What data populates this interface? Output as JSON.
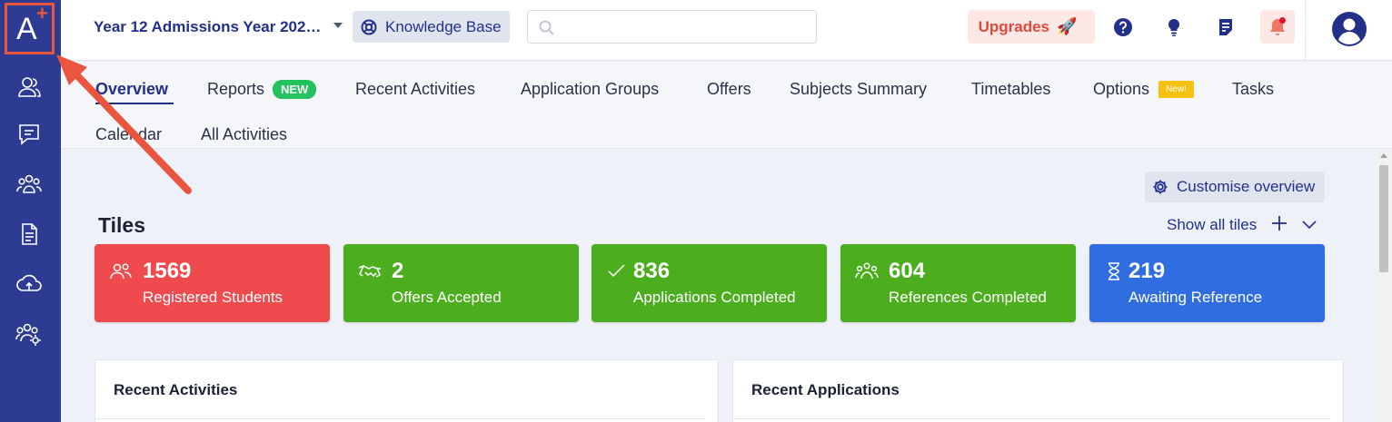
{
  "sidebar": {
    "logo_letter": "A",
    "logo_plus": "+",
    "icons": [
      "users-icon",
      "chat-icon",
      "group-icon",
      "document-icon",
      "cloud-upload-icon",
      "group-settings-icon"
    ]
  },
  "header": {
    "year_label": "Year 12 Admissions Year 202…",
    "knowledge_base_label": "Knowledge Base",
    "search_placeholder": "",
    "upgrades_label": "Upgrades",
    "upgrades_icon": "🚀"
  },
  "tabs": {
    "items": [
      {
        "label": "Overview"
      },
      {
        "label": "Reports"
      },
      {
        "label": "Recent Activities"
      },
      {
        "label": "Application Groups"
      },
      {
        "label": "Offers"
      },
      {
        "label": "Subjects Summary"
      },
      {
        "label": "Timetables"
      },
      {
        "label": "Options"
      },
      {
        "label": "Tasks"
      },
      {
        "label": "Calendar"
      },
      {
        "label": "All Activities"
      }
    ],
    "reports_badge": "NEW",
    "options_badge": "New!"
  },
  "overview": {
    "customise_label": "Customise overview",
    "tiles_title": "Tiles",
    "show_all_label": "Show all tiles",
    "tiles": [
      {
        "value": "1569",
        "label": "Registered Students",
        "color": "#ef4b4f",
        "icon": "users-icon"
      },
      {
        "value": "2",
        "label": "Offers Accepted",
        "color": "#4cae1f",
        "icon": "handshake-icon"
      },
      {
        "value": "836",
        "label": "Applications Completed",
        "color": "#4cae1f",
        "icon": "check-icon"
      },
      {
        "value": "604",
        "label": "References Completed",
        "color": "#4cae1f",
        "icon": "group-icon"
      },
      {
        "value": "219",
        "label": "Awaiting Reference",
        "color": "#2f6de0",
        "icon": "hourglass-icon"
      }
    ],
    "panels": [
      {
        "title": "Recent Activities"
      },
      {
        "title": "Recent Applications"
      }
    ]
  },
  "colors": {
    "sidebar": "#2d3b93",
    "accent": "#23308a",
    "annotation": "#e9553e"
  }
}
